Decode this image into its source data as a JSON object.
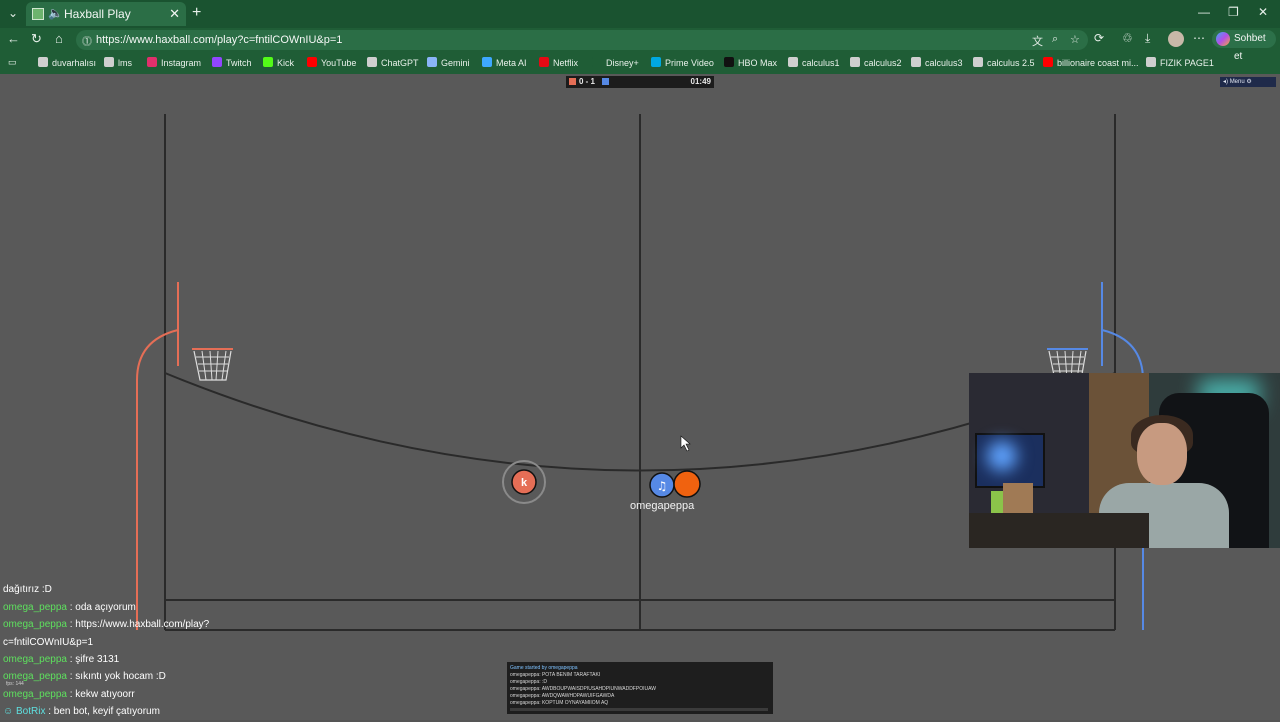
{
  "browser": {
    "tab_title": "Haxball Play",
    "url": "https://www.haxball.com/play?c=fntilCOWnIU&p=1",
    "chat_button": "Sohbet et"
  },
  "bookmarks": [
    {
      "label": "duvarhalısı",
      "color": "#cfcfcf"
    },
    {
      "label": "lms",
      "color": "#cfcfcf"
    },
    {
      "label": "Instagram",
      "color": "#e1306c"
    },
    {
      "label": "Twitch",
      "color": "#9146ff"
    },
    {
      "label": "Kick",
      "color": "#53fc18"
    },
    {
      "label": "YouTube",
      "color": "#ff0000"
    },
    {
      "label": "ChatGPT",
      "color": "#cfcfcf"
    },
    {
      "label": "Gemini",
      "color": "#8ab4f8"
    },
    {
      "label": "Meta AI",
      "color": "#3ea8ff"
    },
    {
      "label": "Netflix",
      "color": "#e50914"
    },
    {
      "label": "Disney+",
      "color": "#1f5d36"
    },
    {
      "label": "Prime Video",
      "color": "#00a8e1"
    },
    {
      "label": "HBO Max",
      "color": "#111111"
    },
    {
      "label": "calculus1",
      "color": "#cfcfcf"
    },
    {
      "label": "calculus2",
      "color": "#cfcfcf"
    },
    {
      "label": "calculus3",
      "color": "#cfcfcf"
    },
    {
      "label": "calculus 2.5",
      "color": "#cfcfcf"
    },
    {
      "label": "billionaire coast mi...",
      "color": "#ff0000"
    },
    {
      "label": "FIZIK PAGE1",
      "color": "#cfcfcf"
    }
  ],
  "game": {
    "score": "0 - 1",
    "time": "01:49",
    "menu_label": "Menu",
    "player_name": "omegapeppa",
    "red_player_avatar": "k",
    "blue_player_avatar": "♫",
    "colors": {
      "red": "#e56e56",
      "blue": "#5689e5",
      "ball": "#f0620f",
      "field": "#595959"
    }
  },
  "chat": [
    {
      "user": "",
      "text": "dağıtırız :D"
    },
    {
      "user": "omega_peppa",
      "text": " : oda açıyorum"
    },
    {
      "user": "omega_peppa",
      "text": " : https://www.haxball.com/play?"
    },
    {
      "user": "",
      "text": "c=fntilCOWnIU&p=1"
    },
    {
      "user": "omega_peppa",
      "text": " : şifre 3131"
    },
    {
      "user": "omega_peppa",
      "text": " : sıkıntı yok hocam :D"
    },
    {
      "user": "omega_peppa",
      "text": " : kekw atıyoorr"
    },
    {
      "user": "BotRix",
      "text": " : ben bot, keyif çatıyorum"
    }
  ],
  "fps": "fps: 144",
  "game_log": [
    "Game started by omegapeppa",
    "omegapeppa: POTA BENIM TARAFTAKI",
    "omegapeppa: :D",
    "omegapeppa: AWDBOUPWAISDPIUSAHDPIUNWADDFPOIUAW",
    "omegapeppa: AWDQWAWHDPAWUIFGAWDA",
    "omegapeppa: KOPTUM OYNAYAMIIOM AQ"
  ]
}
